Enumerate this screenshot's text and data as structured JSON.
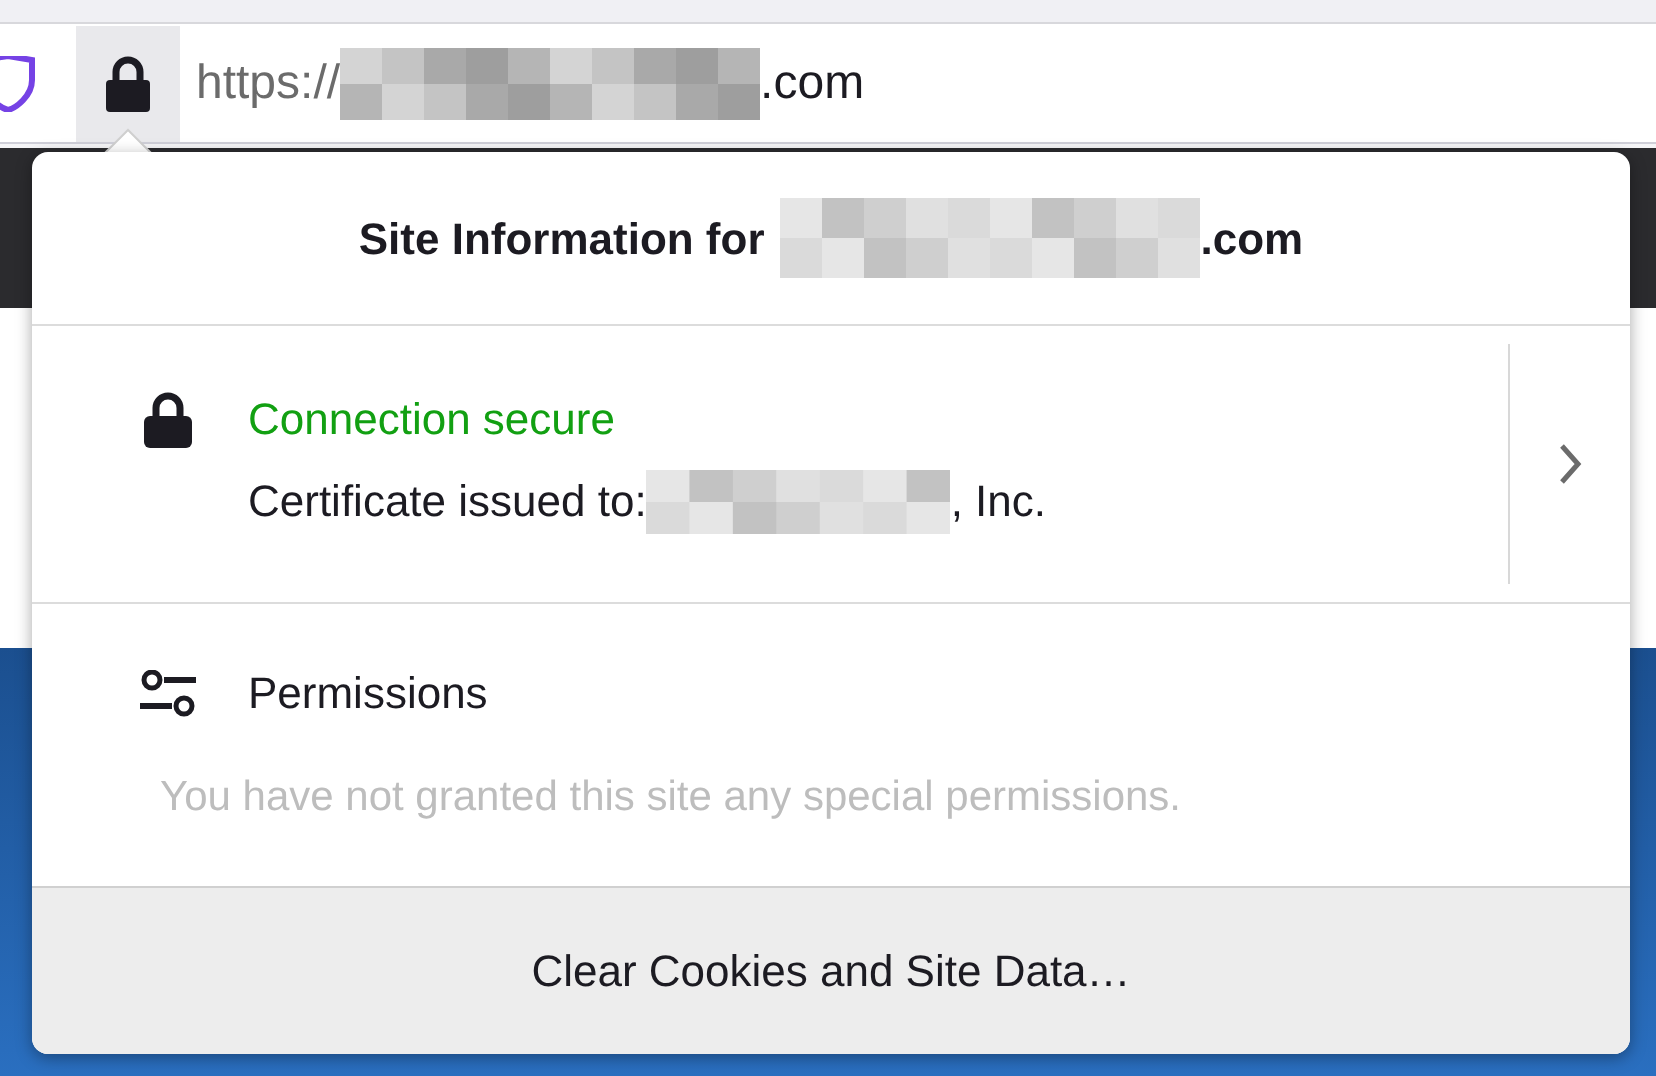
{
  "address_bar": {
    "scheme": "https://",
    "domain_suffix": ".com"
  },
  "panel": {
    "title": "Site Information for",
    "title_suffix": ".com",
    "connection": {
      "status": "Connection secure",
      "secure": true,
      "certificate_prefix": "Certificate issued to:",
      "certificate_suffix": ", Inc."
    },
    "permissions": {
      "heading": "Permissions",
      "message": "You have not granted this site any special permissions."
    },
    "footer_button": "Clear Cookies and Site Data…"
  }
}
